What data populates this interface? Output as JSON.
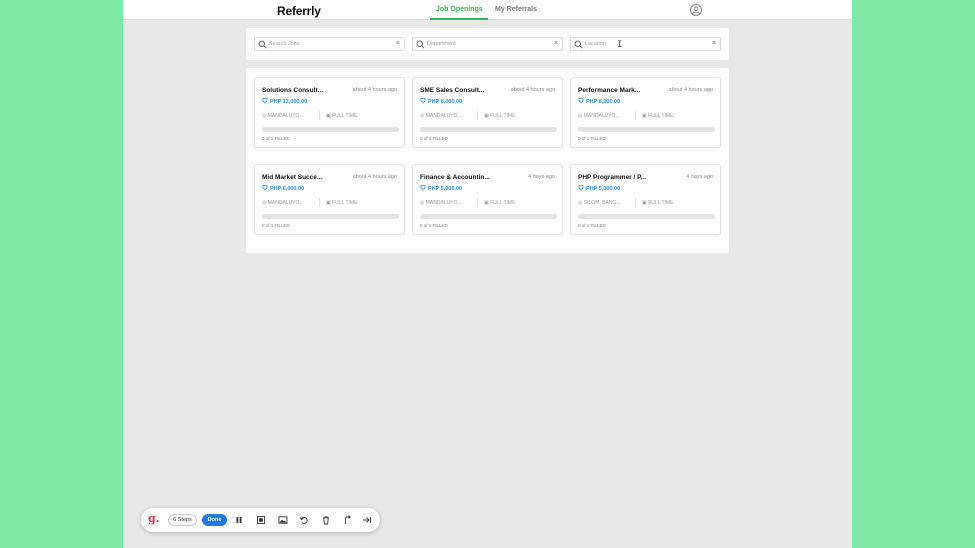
{
  "header": {
    "logo": "Referrly",
    "tabs": [
      {
        "label": "Job Openings",
        "active": true
      },
      {
        "label": "My Referrals",
        "active": false
      }
    ]
  },
  "search": {
    "jobs_placeholder": "Search Jobs",
    "department_placeholder": "Department",
    "location_placeholder": "Location",
    "clear": "×"
  },
  "jobs": [
    {
      "title": "Solutions Consult...",
      "time": "about 4 hours ago",
      "salary": "PHP 12,000.00",
      "location": "MANDALUYO...",
      "type": "FULL TIME",
      "filled": "0 of 1 FILLED",
      "progress": 0
    },
    {
      "title": "SME Sales Consult...",
      "time": "about 4 hours ago",
      "salary": "PHP 8,000.00",
      "location": "MANDALUYO...",
      "type": "FULL TIME",
      "filled": "0 of 1 FILLED",
      "progress": 0
    },
    {
      "title": "Performance Mark...",
      "time": "about 4 hours ago",
      "salary": "PHP 8,000.00",
      "location": "MANDALUYO...",
      "type": "FULL TIME",
      "filled": "0 of 1 FILLED",
      "progress": 0
    },
    {
      "title": "Mid Market Succe...",
      "time": "about 4 hours ago",
      "salary": "PHP 6,000.00",
      "location": "MANDALUYO...",
      "type": "FULL TIME",
      "filled": "0 of 1 FILLED",
      "progress": 0
    },
    {
      "title": "Finance & Accountin...",
      "time": "4 days ago",
      "salary": "PHP 5,000.00",
      "location": "MANDALUYO...",
      "type": "FULL TIME",
      "filled": "0 of 1 FILLED",
      "progress": 0
    },
    {
      "title": "PHP Programmer / P...",
      "time": "4 days ago",
      "salary": "PHP 5,000.00",
      "location": "SILOM, BANG...",
      "type": "FULL TIME",
      "filled": "0 of 1 FILLED",
      "progress": 0
    }
  ],
  "recorder": {
    "logo": "g.",
    "steps": "6 Steps",
    "done": "Done",
    "icons": [
      "pause-icon",
      "stop-icon",
      "image-icon",
      "undo-icon",
      "trash-icon",
      "share-icon",
      "skip-icon"
    ]
  },
  "colors": {
    "accent_green": "#2fb55a",
    "salary_blue": "#2a8fd4",
    "done_blue": "#1e78e0",
    "backdrop": "#7ee8a6"
  }
}
